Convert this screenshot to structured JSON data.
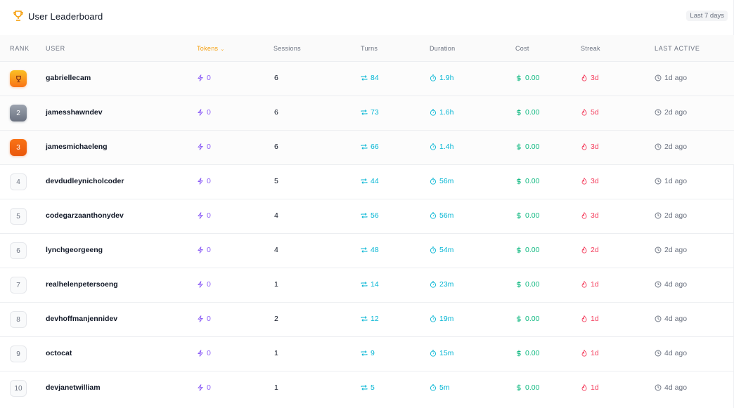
{
  "header": {
    "title": "User Leaderboard",
    "range": "Last 7 days"
  },
  "columns": {
    "rank": "Rank",
    "user": "User",
    "tokens": "Tokens",
    "sessions": "Sessions",
    "turns": "Turns",
    "duration": "Duration",
    "cost": "Cost",
    "streak": "Streak",
    "last_active": "Last Active"
  },
  "rows": [
    {
      "rank": "",
      "user": "gabriellecam",
      "tokens": "0",
      "sessions": "6",
      "turns": "84",
      "duration": "1.9h",
      "cost": "0.00",
      "streak": "3d",
      "last": "1d ago"
    },
    {
      "rank": "2",
      "user": "jamesshawndev",
      "tokens": "0",
      "sessions": "6",
      "turns": "73",
      "duration": "1.6h",
      "cost": "0.00",
      "streak": "5d",
      "last": "2d ago"
    },
    {
      "rank": "3",
      "user": "jamesmichaeleng",
      "tokens": "0",
      "sessions": "6",
      "turns": "66",
      "duration": "1.4h",
      "cost": "0.00",
      "streak": "3d",
      "last": "2d ago"
    },
    {
      "rank": "4",
      "user": "devdudleynicholcoder",
      "tokens": "0",
      "sessions": "5",
      "turns": "44",
      "duration": "56m",
      "cost": "0.00",
      "streak": "3d",
      "last": "1d ago"
    },
    {
      "rank": "5",
      "user": "codegarzaanthonydev",
      "tokens": "0",
      "sessions": "4",
      "turns": "56",
      "duration": "56m",
      "cost": "0.00",
      "streak": "3d",
      "last": "2d ago"
    },
    {
      "rank": "6",
      "user": "lynchgeorgeeng",
      "tokens": "0",
      "sessions": "4",
      "turns": "48",
      "duration": "54m",
      "cost": "0.00",
      "streak": "2d",
      "last": "2d ago"
    },
    {
      "rank": "7",
      "user": "realhelenpetersoeng",
      "tokens": "0",
      "sessions": "1",
      "turns": "14",
      "duration": "23m",
      "cost": "0.00",
      "streak": "1d",
      "last": "4d ago"
    },
    {
      "rank": "8",
      "user": "devhoffmanjennidev",
      "tokens": "0",
      "sessions": "2",
      "turns": "12",
      "duration": "19m",
      "cost": "0.00",
      "streak": "1d",
      "last": "4d ago"
    },
    {
      "rank": "9",
      "user": "octocat",
      "tokens": "0",
      "sessions": "1",
      "turns": "9",
      "duration": "15m",
      "cost": "0.00",
      "streak": "1d",
      "last": "4d ago"
    },
    {
      "rank": "10",
      "user": "devjanetwilliam",
      "tokens": "0",
      "sessions": "1",
      "turns": "5",
      "duration": "5m",
      "cost": "0.00",
      "streak": "1d",
      "last": "4d ago"
    }
  ],
  "icons": {
    "title": "trophy-icon",
    "tokens": "zap-icon",
    "turns": "repeat-icon",
    "duration": "timer-icon",
    "cost": "dollar-icon",
    "streak": "flame-icon",
    "last": "clock-icon",
    "sort": "chevron-down-icon",
    "rank1": "trophy-icon"
  },
  "colors": {
    "accent": "#f59e0b",
    "tokens": "#8b5cf6",
    "turns": "#06b6d4",
    "cost": "#10b981",
    "streak": "#f43f5e"
  }
}
